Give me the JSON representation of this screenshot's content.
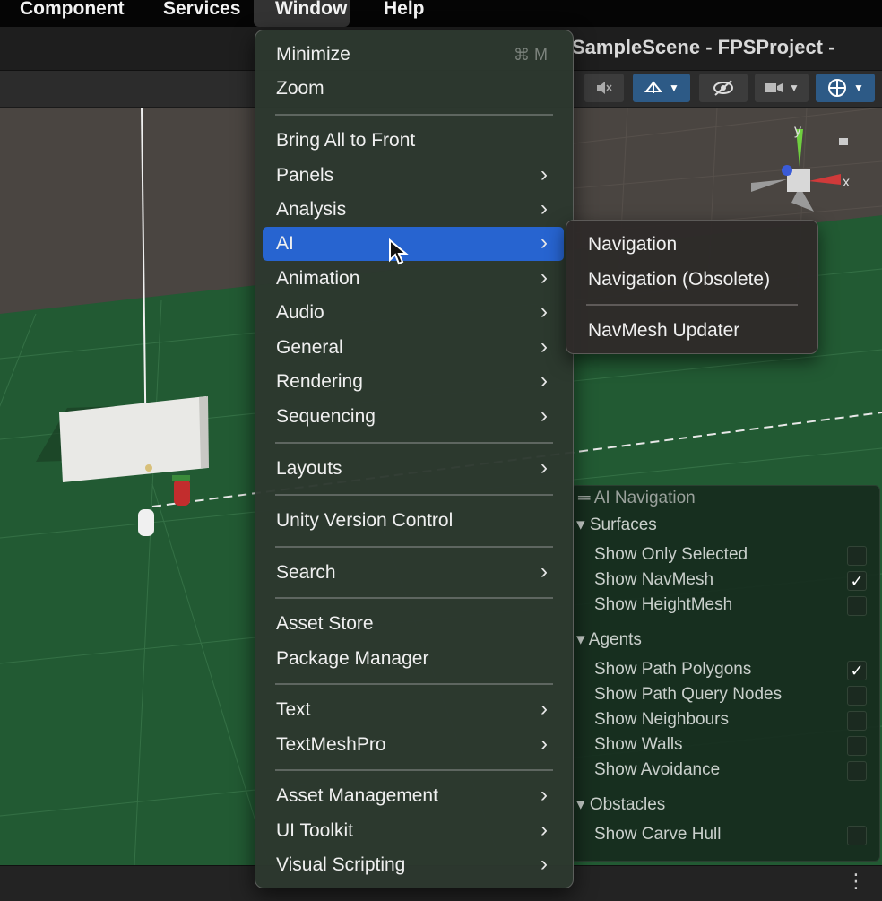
{
  "menubar": {
    "component": "Component",
    "services": "Services",
    "window": "Window",
    "help": "Help"
  },
  "editor": {
    "scene_title": "SampleScene - FPSProject - "
  },
  "gizmo": {
    "y_label": "y",
    "x_label": "x"
  },
  "window_menu": {
    "minimize": "Minimize",
    "minimize_shortcut": "⌘ M",
    "zoom": "Zoom",
    "bring_all_to_front": "Bring All to Front",
    "panels": "Panels",
    "analysis": "Analysis",
    "ai": "AI",
    "animation": "Animation",
    "audio": "Audio",
    "general": "General",
    "rendering": "Rendering",
    "sequencing": "Sequencing",
    "layouts": "Layouts",
    "unity_version_control": "Unity Version Control",
    "search": "Search",
    "asset_store": "Asset Store",
    "package_manager": "Package Manager",
    "text": "Text",
    "textmeshpro": "TextMeshPro",
    "asset_management": "Asset Management",
    "ui_toolkit": "UI Toolkit",
    "visual_scripting": "Visual Scripting",
    "arrow": "›"
  },
  "ai_submenu": {
    "navigation": "Navigation",
    "navigation_obsolete": "Navigation (Obsolete)",
    "navmesh_updater": "NavMesh Updater"
  },
  "ai_navigation": {
    "title": "AI Navigation",
    "surfaces": "Surfaces",
    "show_only_selected": "Show Only Selected",
    "show_navmesh": "Show NavMesh",
    "show_heightmesh": "Show HeightMesh",
    "agents": "Agents",
    "show_path_polygons": "Show Path Polygons",
    "show_path_query_nodes": "Show Path Query Nodes",
    "show_neighbours": "Show Neighbours",
    "show_walls": "Show Walls",
    "show_avoidance": "Show Avoidance",
    "obstacles": "Obstacles",
    "show_carve_hull": "Show Carve Hull",
    "checked": {
      "show_only_selected": false,
      "show_navmesh": true,
      "show_heightmesh": false,
      "show_path_polygons": true,
      "show_path_query_nodes": false,
      "show_neighbours": false,
      "show_walls": false,
      "show_avoidance": false,
      "show_carve_hull": false
    },
    "checkmark": "✓"
  },
  "colors": {
    "menu_highlight": "#2764d0",
    "ground": "#225a33",
    "toolbar_active": "#2d5a86"
  }
}
